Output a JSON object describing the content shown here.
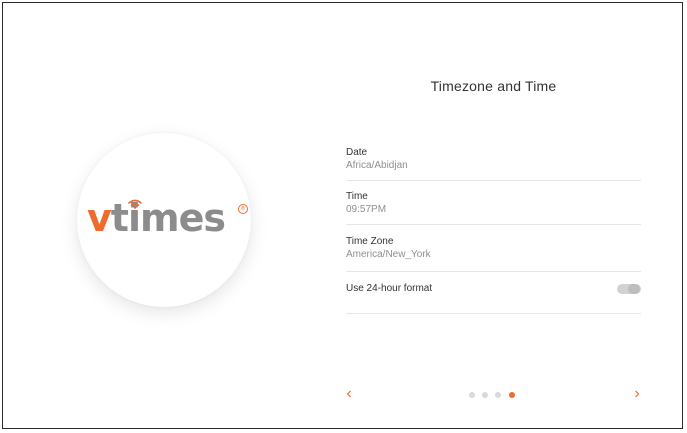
{
  "logo": {
    "brand_prefix": "v",
    "brand_rest": "times",
    "registered_mark": "®",
    "primary_color": "#ee6c2d",
    "text_color": "#8c8c8c"
  },
  "page": {
    "title": "Timezone and Time"
  },
  "settings": {
    "date": {
      "label": "Date",
      "value": "Africa/Abidjan"
    },
    "time": {
      "label": "Time",
      "value": "09:57PM"
    },
    "timezone": {
      "label": "Time Zone",
      "value": "America/New_York"
    },
    "format24": {
      "label": "Use 24-hour format",
      "enabled": false
    }
  },
  "navigation": {
    "prev_icon": "chevron-left-icon",
    "next_icon": "chevron-right-icon",
    "prev_glyph": "‹",
    "next_glyph": "›",
    "page_count": 4,
    "current_page": 4,
    "accent_color": "#ee6c2d"
  }
}
